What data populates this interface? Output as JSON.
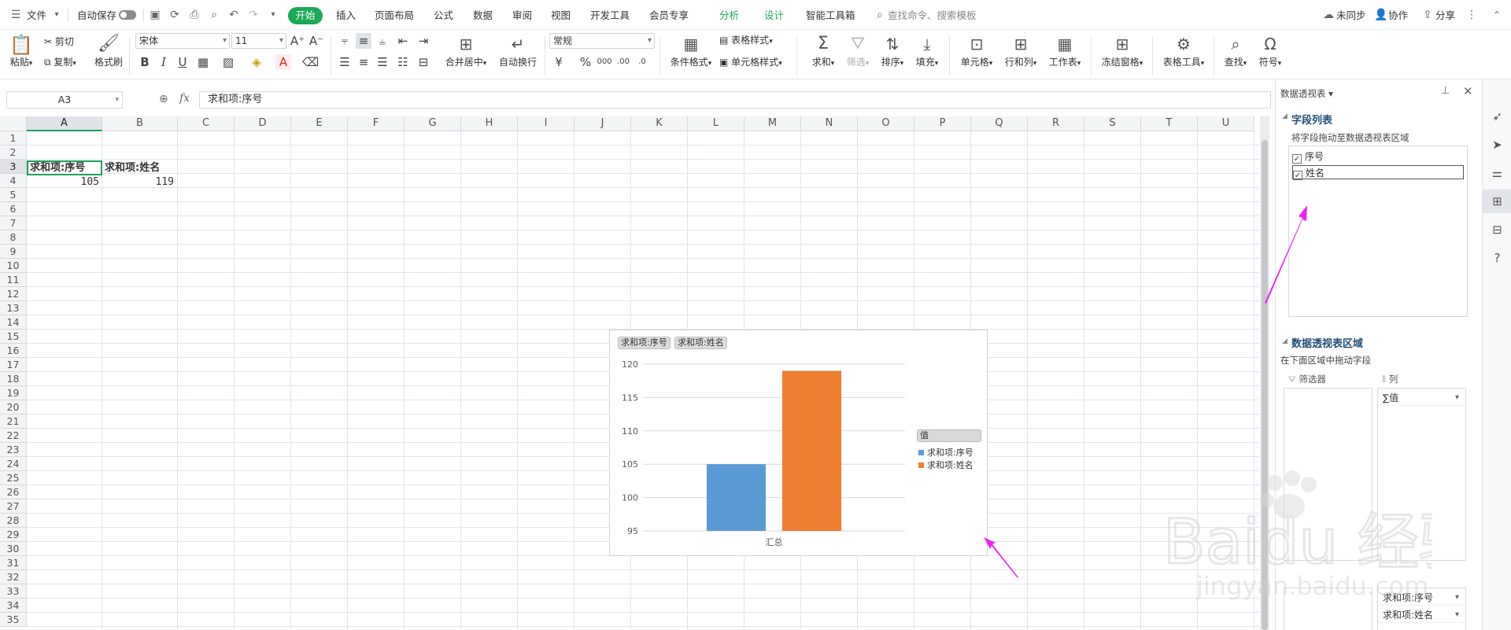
{
  "menubar": {
    "file": "文件",
    "autosave": "自动保存",
    "tabs": [
      "开始",
      "插入",
      "页面布局",
      "公式",
      "数据",
      "审阅",
      "视图",
      "开发工具",
      "会员专享",
      "分析",
      "设计",
      "智能工具箱"
    ],
    "search": "查找命令、搜索模板",
    "sync": "未同步",
    "collab": "协作",
    "share": "分享"
  },
  "ribbon": {
    "paste": "粘贴",
    "cut": "剪切",
    "copy": "复制",
    "format_painter": "格式刷",
    "font": "宋体",
    "size": "11",
    "merge": "合并居中",
    "wrap": "自动换行",
    "number_format": "常规",
    "cond_format": "条件格式",
    "table_style": "表格样式",
    "cell_style": "单元格样式",
    "sum": "求和",
    "filter": "筛选",
    "sort": "排序",
    "fill": "填充",
    "cell": "单元格",
    "rowcol": "行和列",
    "sheet": "工作表",
    "freeze": "冻结窗格",
    "table_tools": "表格工具",
    "find": "查找",
    "symbol": "符号"
  },
  "formula_bar": {
    "name_box": "A3",
    "fx": "fx",
    "content": "求和项:序号"
  },
  "sheet": {
    "columns": [
      "A",
      "B",
      "C",
      "D",
      "E",
      "F",
      "G",
      "H",
      "I",
      "J",
      "K",
      "L",
      "M",
      "N",
      "O",
      "P",
      "Q",
      "R",
      "S",
      "T",
      "U"
    ],
    "rows": [
      "1",
      "2",
      "3",
      "4",
      "5",
      "6",
      "7",
      "8",
      "9",
      "10",
      "11",
      "12",
      "13",
      "14",
      "15",
      "16",
      "17",
      "18",
      "19",
      "20",
      "21",
      "22",
      "23",
      "24",
      "25",
      "26",
      "27",
      "28",
      "29",
      "30",
      "31",
      "32",
      "33",
      "34",
      "35"
    ],
    "a3": "求和项:序号",
    "b3": "求和项:姓名",
    "a4": "105",
    "b4": "119"
  },
  "chart_data": {
    "type": "bar",
    "categories": [
      "汇总"
    ],
    "series": [
      {
        "name": "求和项:序号",
        "values": [
          105
        ],
        "color": "#5b9bd5"
      },
      {
        "name": "求和项:姓名",
        "values": [
          119
        ],
        "color": "#ed7d31"
      }
    ],
    "field_buttons": [
      "求和项:序号",
      "求和项:姓名"
    ],
    "legend_title": "值",
    "ylim": [
      95,
      120
    ],
    "yticks": [
      "95",
      "100",
      "105",
      "110",
      "115",
      "120"
    ],
    "grid": true,
    "legend_position": "right"
  },
  "pivot_panel": {
    "header": "数据透视表",
    "field_list_title": "字段列表",
    "field_list_hint": "将字段拖动至数据透视表区域",
    "fields": [
      "序号",
      "姓名"
    ],
    "areas_title": "数据透视表区域",
    "areas_hint": "在下面区域中拖动字段",
    "filter_label": "筛选器",
    "column_label": "列",
    "column_value": "∑值",
    "values": [
      "求和项:序号",
      "求和项:姓名"
    ]
  },
  "colors": {
    "accent": "#1aaa55",
    "annotation_arrow": "#ee22ee"
  },
  "watermark": {
    "brand": "Baidu 经验",
    "url": "jingyan.baidu.com"
  }
}
